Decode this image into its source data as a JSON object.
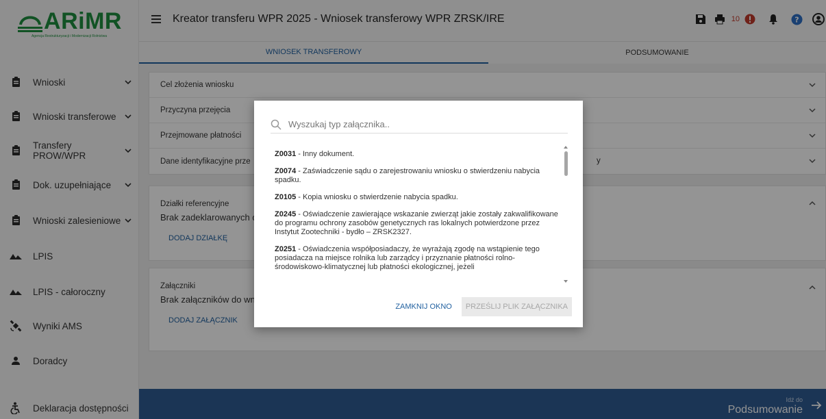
{
  "brand": {
    "logo_text": "ARiMR",
    "logo_subtitle": "Agencja Restrukturyzacji i Modernizacji Rolnictwa"
  },
  "sidebar": {
    "items": [
      {
        "label": "Wnioski",
        "icon": "clipboard-icon",
        "has_chevron": true
      },
      {
        "label": "Wnioski transferowe",
        "icon": "clipboard-icon",
        "has_chevron": true
      },
      {
        "label": "Transfery PROW/WPR",
        "icon": "clipboard-icon",
        "has_chevron": true
      },
      {
        "label": "Dok. uzupełniające",
        "icon": "clipboard-icon",
        "has_chevron": true
      },
      {
        "label": "Wnioski zalesieniowe",
        "icon": "clipboard-icon",
        "has_chevron": true
      },
      {
        "label": "LPIS",
        "icon": "terrain-icon",
        "has_chevron": false
      },
      {
        "label": "LPIS - całoroczny",
        "icon": "terrain-icon",
        "has_chevron": false
      },
      {
        "label": "Wyniki AMS",
        "icon": "satellite-icon",
        "has_chevron": false
      },
      {
        "label": "Doradcy",
        "icon": "person-icon",
        "has_chevron": false
      },
      {
        "label": "Deklaracja dostępności",
        "icon": "accessibility-icon",
        "has_chevron": false
      }
    ]
  },
  "header": {
    "title": "Kreator transferu WPR 2025 - Wniosek transferowy WPR ZRSK/IRE",
    "notification_count": "10"
  },
  "tabs": [
    {
      "label": "WNIOSEK TRANSFEROWY",
      "active": true
    },
    {
      "label": "PODSUMOWANIE",
      "active": false
    }
  ],
  "main": {
    "accordions": [
      {
        "label": "Cel złożenia wniosku"
      },
      {
        "label": "Przyczyna przejęcia"
      },
      {
        "label": "Przejmowane płatności"
      },
      {
        "label": "Dane identyfikacyjne prze"
      }
    ],
    "accordion_tail": "y",
    "parcels": {
      "title": "Działki referencyjne",
      "empty_text": "Brak zadeklarowanych d",
      "add_label": "DODAJ DZIAŁKĘ"
    },
    "attachments": {
      "title": "Załączniki",
      "empty_text": "Brak załączników do wn",
      "add_label": "DODAJ ZAŁĄCZNIK"
    }
  },
  "footer": {
    "hint": "Idź do",
    "target": "Podsumowanie"
  },
  "modal": {
    "search_placeholder": "Wyszukaj typ załącznika..",
    "items": [
      {
        "code": "Z0031",
        "text": " - Inny dokument."
      },
      {
        "code": "Z0074",
        "text": " - Zaświadczenie sądu o zarejestrowaniu wniosku o stwierdzeniu nabycia spadku."
      },
      {
        "code": "Z0105",
        "text": " - Kopia wniosku o stwierdzenie nabycia spadku."
      },
      {
        "code": "Z0245",
        "text": " - Oświadczenie zawierające wskazanie zwierząt jakie zostały zakwalifikowane do programu ochrony zasobów genetycznych ras lokalnych potwierdzone przez Instytut Zootechniki - bydło – ZRSK2327."
      },
      {
        "code": "Z0251",
        "text": " - Oświadczenia współposiadaczy, że wyrażają zgodę na wstąpienie tego posiadacza na miejsce rolnika lub zarządcy i przyznanie płatności rolno-środowiskowo-klimatycznej lub płatności ekologicznej, jeżeli"
      }
    ],
    "close_label": "ZAMKNIJ OKNO",
    "upload_label": "PRZEŚLIJ PLIK ZAŁĄCZNIKA"
  }
}
